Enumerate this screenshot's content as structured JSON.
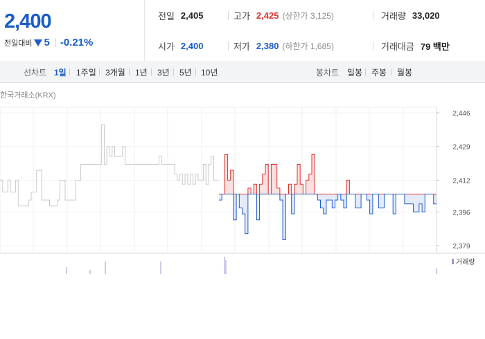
{
  "quote": {
    "price": "2,400",
    "change_label": "전일대비",
    "change_value": "5",
    "change_percent": "-0.21%",
    "direction": "down"
  },
  "stats": {
    "prev_close": {
      "label": "전일",
      "value": "2,405"
    },
    "high": {
      "label": "고가",
      "value": "2,425",
      "sub": "(상한가 3,125)"
    },
    "volume": {
      "label": "거래량",
      "value": "33,020"
    },
    "open": {
      "label": "시가",
      "value": "2,400"
    },
    "low": {
      "label": "저가",
      "value": "2,380",
      "sub": "(하한가 1,685)"
    },
    "amount": {
      "label": "거래대금",
      "value": "79 백만"
    }
  },
  "tabs": {
    "line_label": "선차트",
    "line_items": [
      "1일",
      "1주일",
      "3개월",
      "1년",
      "3년",
      "5년",
      "10년"
    ],
    "line_active": 0,
    "candle_label": "봉차트",
    "candle_items": [
      "일봉",
      "주봉",
      "월봉"
    ]
  },
  "colors": {
    "up": "#e0312a",
    "down": "#1b5cc9",
    "volume": "#a592cf",
    "prev_line": "#c9c9c9"
  },
  "chart_data": {
    "type": "line",
    "source": "한국거래소(KRX)",
    "y_ticks": [
      "2,446",
      "2,429",
      "2,412",
      "2,396",
      "2,379"
    ],
    "ylim": [
      2379,
      2446
    ],
    "base_price": 2405,
    "volume_legend": "거래량",
    "prev_series": [
      2412,
      2406,
      2406,
      2412,
      2406,
      2406,
      2412,
      2399,
      2399,
      2399,
      2399,
      2402,
      2406,
      2406,
      2417,
      2417,
      2402,
      2402,
      2402,
      2399,
      2399,
      2399,
      2402,
      2412,
      2412,
      2402,
      2402,
      2402,
      2402,
      2412,
      2412,
      2420,
      2420,
      2420,
      2420,
      2420,
      2420,
      2420,
      2420,
      2440,
      2420,
      2429,
      2424,
      2429,
      2424,
      2424,
      2424,
      2429,
      2420,
      2420,
      2420,
      2420,
      2420,
      2420,
      2420,
      2420,
      2420,
      2420,
      2420,
      2420,
      2420,
      2424,
      2420,
      2420,
      2420,
      2420,
      2420,
      2415,
      2412,
      2415,
      2410,
      2415,
      2410,
      2415,
      2410,
      2415,
      2412,
      2412,
      2420,
      2410,
      2420,
      2424,
      2412,
      2412
    ],
    "today_series": [
      2402,
      2405,
      2425,
      2412,
      2417,
      2392,
      2405,
      2398,
      2395,
      2385,
      2408,
      2405,
      2410,
      2392,
      2410,
      2415,
      2420,
      2405,
      2420,
      2420,
      2408,
      2402,
      2382,
      2405,
      2410,
      2395,
      2410,
      2420,
      2410,
      2405,
      2412,
      2415,
      2425,
      2405,
      2402,
      2398,
      2395,
      2402,
      2402,
      2398,
      2402,
      2405,
      2402,
      2398,
      2412,
      2405,
      2405,
      2398,
      2398,
      2405,
      2405,
      2402,
      2395,
      2405,
      2405,
      2398,
      2398,
      2405,
      2405,
      2405,
      2395,
      2405,
      2405,
      2405,
      2400,
      2400,
      2400,
      2396,
      2396,
      2400,
      2396,
      2405,
      2405,
      2405,
      2400
    ]
  }
}
